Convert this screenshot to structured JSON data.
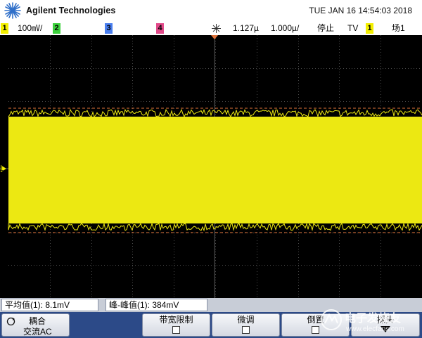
{
  "header": {
    "brand": "Agilent Technologies",
    "datetime": "TUE JAN 16 14:54:03 2018"
  },
  "status": {
    "ch1": "1",
    "ch1_scale": "100㎷/",
    "ch2": "2",
    "ch3": "3",
    "ch4": "4",
    "time_pos": "1.127µ",
    "time_scale": "1.000µ/",
    "run_state": "停止",
    "trigger_mode": "TV",
    "trigger_source": "1",
    "trigger_type": "场1"
  },
  "colors": {
    "ch1": "#f3ef00",
    "ch2": "#3cd13c",
    "ch3": "#4a7ff0",
    "ch4": "#e24a8a",
    "trace": "#ece812",
    "softkey_bg": "#2c4a88"
  },
  "marker": {
    "ch1": "1"
  },
  "measurements": {
    "avg": "平均值(1): 8.1mV",
    "pkpk": "峰-峰值(1): 384mV"
  },
  "softkeys": {
    "coupling_label": "耦合",
    "coupling_value": "交流AC",
    "bw_limit": "带宽限制",
    "fine": "微调",
    "invert": "倒置",
    "probe": "探头"
  },
  "watermark": {
    "title": "电子发烧友",
    "url": "www.elecfans.com"
  },
  "icons": [
    "agilent-spark-icon",
    "trigger-star-icon",
    "rotate-knob-icon",
    "down-arrow-icon",
    "ground-marker-icon"
  ]
}
